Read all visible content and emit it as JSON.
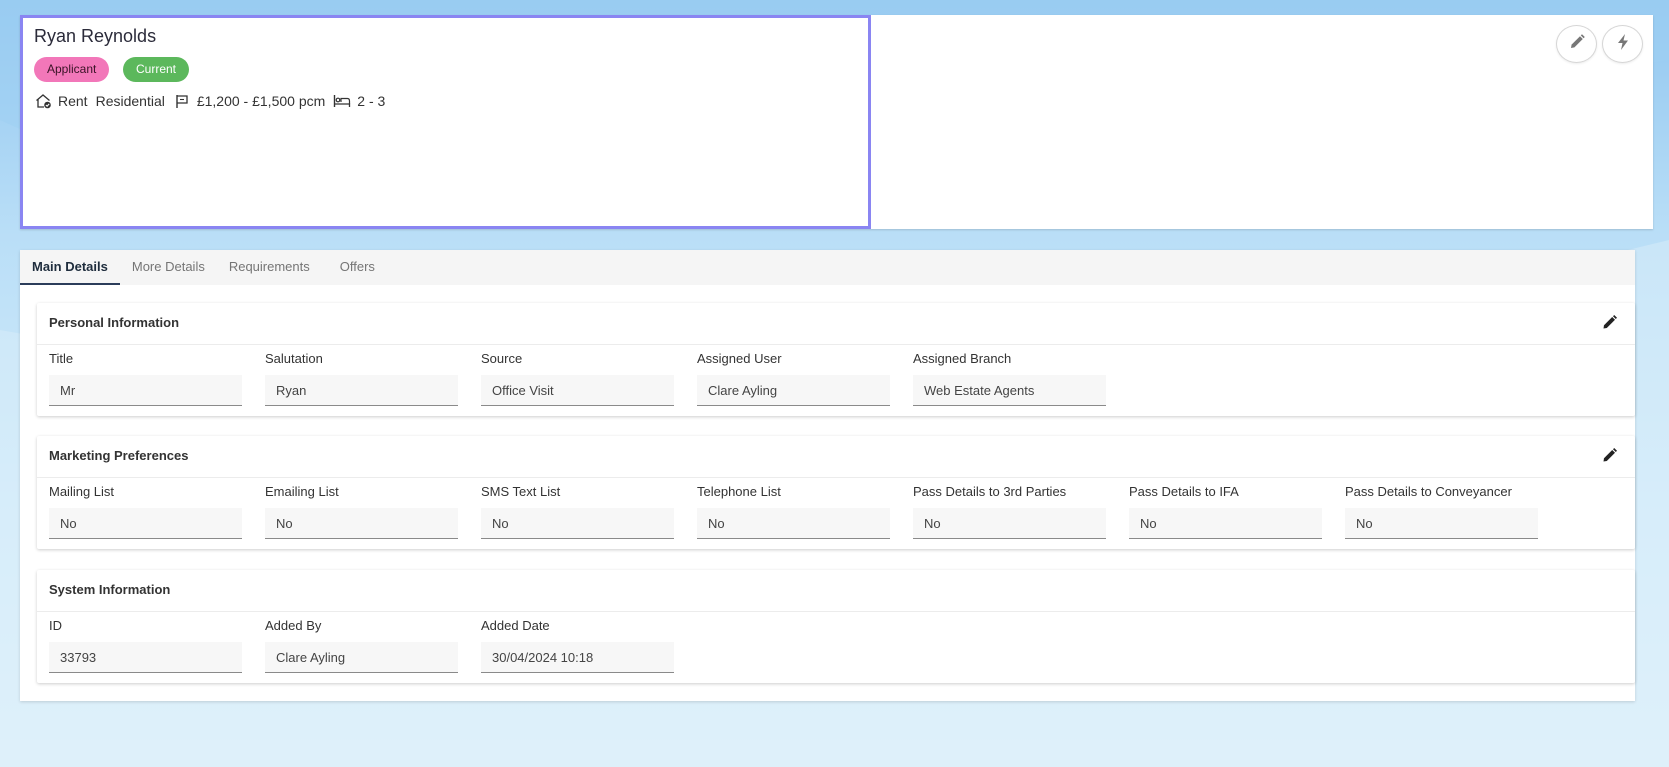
{
  "contact": {
    "name": "Ryan Reynolds",
    "badges": [
      "Applicant",
      "Current"
    ],
    "meta": {
      "type": "Rent",
      "category": "Residential",
      "price": "£1,200 - £1,500 pcm",
      "bedrooms": "2 - 3"
    }
  },
  "tabs": [
    "Main Details",
    "More Details",
    "Requirements",
    "Offers"
  ],
  "active_tab": "Main Details",
  "sections": {
    "personal": {
      "title": "Personal Information",
      "fields": [
        {
          "label": "Title",
          "value": "Mr"
        },
        {
          "label": "Salutation",
          "value": "Ryan"
        },
        {
          "label": "Source",
          "value": "Office Visit"
        },
        {
          "label": "Assigned User",
          "value": "Clare Ayling"
        },
        {
          "label": "Assigned Branch",
          "value": "Web Estate Agents"
        }
      ]
    },
    "marketing": {
      "title": "Marketing Preferences",
      "fields": [
        {
          "label": "Mailing List",
          "value": "No"
        },
        {
          "label": "Emailing List",
          "value": "No"
        },
        {
          "label": "SMS Text List",
          "value": "No"
        },
        {
          "label": "Telephone List",
          "value": "No"
        },
        {
          "label": "Pass Details to 3rd Parties",
          "value": "No"
        },
        {
          "label": "Pass Details to IFA",
          "value": "No"
        },
        {
          "label": "Pass Details to Conveyancer",
          "value": "No"
        }
      ]
    },
    "system": {
      "title": "System Information",
      "fields": [
        {
          "label": "ID",
          "value": "33793"
        },
        {
          "label": "Added By",
          "value": "Clare Ayling"
        },
        {
          "label": "Added Date",
          "value": "30/04/2024 10:18"
        }
      ]
    }
  },
  "colors": {
    "badge_applicant": "#f277b9",
    "badge_current": "#5cb85c",
    "selection_border": "#8a85f2",
    "active_tab_underline": "#2b3c5a"
  },
  "icons": {
    "meta_type": "house-check-icon",
    "meta_price": "price-tag-icon",
    "meta_bedrooms": "bed-icon",
    "header_edit": "pencil-icon",
    "header_action": "lightning-icon",
    "section_edit": "pencil-icon"
  }
}
